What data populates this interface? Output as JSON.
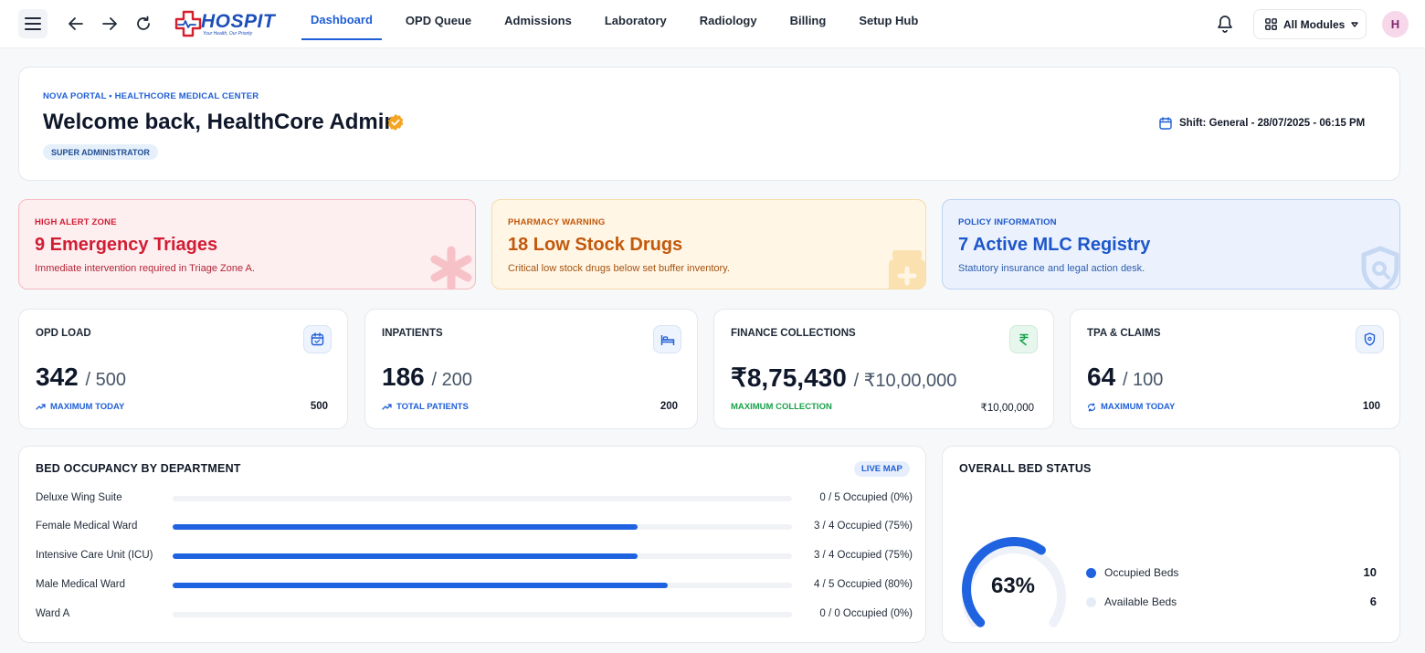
{
  "nav": {
    "brand": "HOSPIT",
    "brand_tagline": "Your Health, Our Priority",
    "tabs": [
      "Dashboard",
      "OPD Queue",
      "Admissions",
      "Laboratory",
      "Radiology",
      "Billing",
      "Setup Hub"
    ],
    "active_tab": "Dashboard",
    "modules_label": "All Modules",
    "avatar_initial": "H"
  },
  "welcome": {
    "breadcrumb": "NOVA PORTAL • HEALTHCORE MEDICAL CENTER",
    "title": "Welcome back, HealthCore Admin",
    "role": "SUPER ADMINISTRATOR",
    "shift": "Shift: General - 28/07/2025 - 06:15 PM"
  },
  "alerts": [
    {
      "kicker": "HIGH ALERT ZONE",
      "title": "9 Emergency Triages",
      "desc": "Immediate intervention required in Triage Zone A."
    },
    {
      "kicker": "PHARMACY WARNING",
      "title": "18 Low Stock Drugs",
      "desc": "Critical low stock drugs below set buffer inventory."
    },
    {
      "kicker": "POLICY INFORMATION",
      "title": "7 Active MLC Registry",
      "desc": "Statutory insurance and legal action desk."
    }
  ],
  "stats": [
    {
      "label": "OPD LOAD",
      "value": "342",
      "max": "/ 500",
      "foot": "MAXIMUM TODAY",
      "foot_value": "500",
      "icon": "calendar-icon"
    },
    {
      "label": "INPATIENTS",
      "value": "186",
      "max": "/ 200",
      "foot": "TOTAL PATIENTS",
      "foot_value": "200",
      "icon": "bed-icon"
    },
    {
      "label": "FINANCE COLLECTIONS",
      "value": "₹8,75,430",
      "max": "/ ₹10,00,000",
      "foot": "MAXIMUM COLLECTION",
      "foot_value": "₹10,00,000",
      "icon": "rupee-icon"
    },
    {
      "label": "TPA & CLAIMS",
      "value": "64",
      "max": "/ 100",
      "foot": "MAXIMUM TODAY",
      "foot_value": "100",
      "icon": "shield-icon"
    }
  ],
  "occupancy": {
    "title": "BED OCCUPANCY BY DEPARTMENT",
    "badge": "LIVE MAP",
    "rows": [
      {
        "name": "Deluxe Wing Suite",
        "stat": "0 / 5 Occupied (0%)",
        "fraction": 0
      },
      {
        "name": "Female Medical Ward",
        "stat": "3 / 4 Occupied (75%)",
        "fraction": 0.75
      },
      {
        "name": "Intensive Care Unit (ICU)",
        "stat": "3 / 4 Occupied (75%)",
        "fraction": 0.75
      },
      {
        "name": "Male Medical Ward",
        "stat": "4 / 5 Occupied (80%)",
        "fraction": 0.8
      },
      {
        "name": "Ward A",
        "stat": "0 / 0 Occupied (0%)",
        "fraction": 0
      }
    ]
  },
  "overall": {
    "title": "OVERALL BED STATUS",
    "percent_label": "63%",
    "fraction": 0.63,
    "legend": [
      {
        "name": "Occupied Beds",
        "value": "10",
        "color": "#1f63e0"
      },
      {
        "name": "Available Beds",
        "value": "6",
        "color": "#e6ecf7"
      }
    ]
  },
  "colors": {
    "accent": "#1f5fd6",
    "danger": "#d11d33",
    "warning": "#c2580b",
    "success": "#17a14a"
  }
}
